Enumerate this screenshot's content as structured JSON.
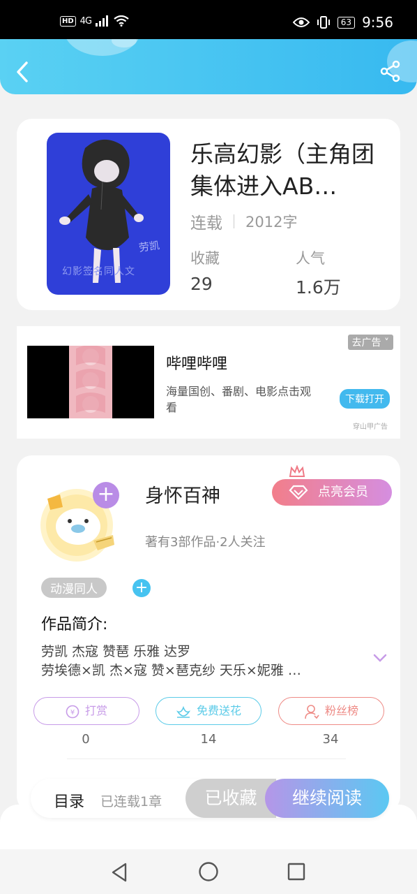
{
  "status_bar": {
    "hd": "HD",
    "network": "4G",
    "battery": "63",
    "time": "9:56"
  },
  "book": {
    "title": "乐高幻影（主角团集体进入AB…",
    "status": "连载",
    "word_count": "2012字",
    "favorites_label": "收藏",
    "favorites_value": "29",
    "popularity_label": "人气",
    "popularity_value": "1.6万",
    "cover_caption": "幻影签名同人文",
    "cover_signature": "劳凯"
  },
  "ad": {
    "title": "哔哩哔哩",
    "description": "海量国创、番剧、电影点击观看",
    "remove_label": "去广告",
    "download_label": "下载打开",
    "source": "穿山甲广告"
  },
  "author": {
    "name": "身怀百神",
    "vip_label": "点亮会员",
    "stats": "著有3部作品·2人关注",
    "tag": "动漫同人",
    "intro_title": "作品简介:",
    "intro_line1": "劳凯 杰寇 赞琶 乐雅 达罗",
    "intro_line2": "劳埃德×凯 杰×寇 赞×琶克纱 天乐×妮雅 …"
  },
  "actions": [
    {
      "label": "打赏",
      "count": "0",
      "color": "#c79be8"
    },
    {
      "label": "免费送花",
      "count": "14",
      "color": "#5bcbe8"
    },
    {
      "label": "粉丝榜",
      "count": "34",
      "color": "#ee8b86"
    }
  ],
  "bottom": {
    "toc_label": "目录",
    "toc_status": "已连载1章",
    "collected_label": "已收藏",
    "read_label": "继续阅读"
  }
}
